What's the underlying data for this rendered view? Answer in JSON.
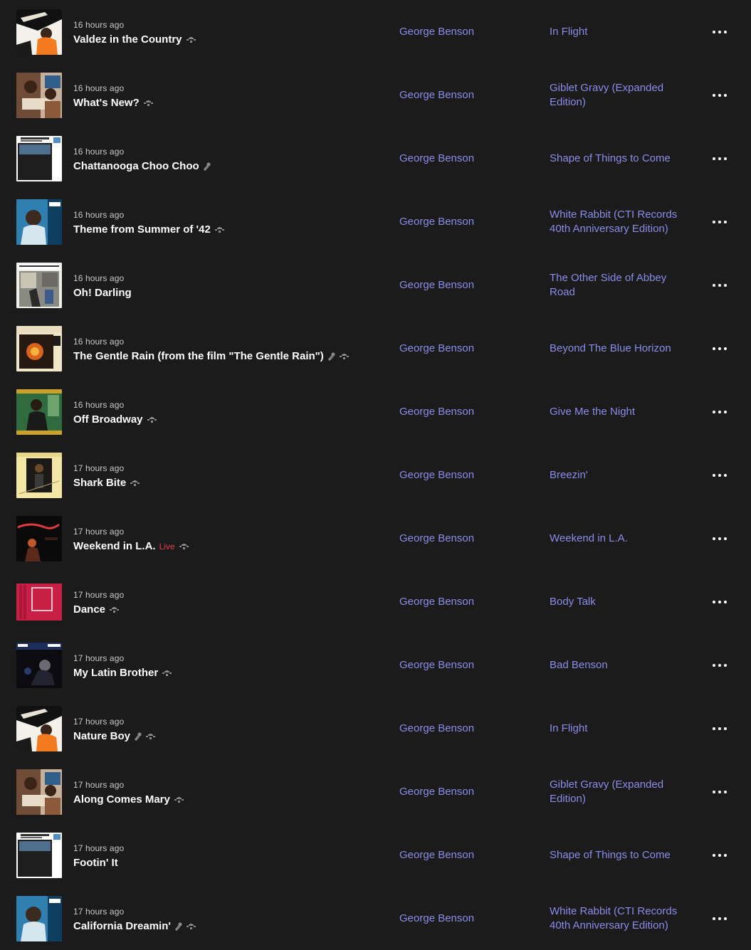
{
  "colors": {
    "background": "#1b1b1c",
    "link": "#8a8ce8",
    "live_badge": "#e8394a",
    "time": "#c9c9c9"
  },
  "tracks": [
    {
      "time": "16 hours ago",
      "title": "Valdez in the Country",
      "live": "",
      "icons": [
        "quality-icon"
      ],
      "artist": "George Benson",
      "album": "In Flight",
      "cover": "in-flight"
    },
    {
      "time": "16 hours ago",
      "title": "What's New?",
      "live": "",
      "icons": [
        "quality-icon"
      ],
      "artist": "George Benson",
      "album": "Giblet Gravy (Expanded Edition)",
      "cover": "giblet"
    },
    {
      "time": "16 hours ago",
      "title": "Chattanooga Choo Choo",
      "live": "",
      "icons": [
        "mic-icon"
      ],
      "artist": "George Benson",
      "album": "Shape of Things to Come",
      "cover": "shape"
    },
    {
      "time": "16 hours ago",
      "title": "Theme from Summer of '42",
      "live": "",
      "icons": [
        "quality-icon"
      ],
      "artist": "George Benson",
      "album": "White Rabbit (CTI Records 40th Anniversary Edition)",
      "cover": "white-rabbit"
    },
    {
      "time": "16 hours ago",
      "title": "Oh! Darling",
      "live": "",
      "icons": [],
      "artist": "George Benson",
      "album": "The Other Side of Abbey Road",
      "cover": "abbey"
    },
    {
      "time": "16 hours ago",
      "title": "The Gentle Rain (from the film \"The Gentle Rain\")",
      "live": "",
      "icons": [
        "mic-icon",
        "quality-icon"
      ],
      "artist": "George Benson",
      "album": "Beyond The Blue Horizon",
      "cover": "blue-horizon"
    },
    {
      "time": "16 hours ago",
      "title": "Off Broadway",
      "live": "",
      "icons": [
        "quality-icon"
      ],
      "artist": "George Benson",
      "album": "Give Me the Night",
      "cover": "give-night"
    },
    {
      "time": "17 hours ago",
      "title": "Shark Bite",
      "live": "",
      "icons": [
        "quality-icon"
      ],
      "artist": "George Benson",
      "album": "Breezin'",
      "cover": "breezin"
    },
    {
      "time": "17 hours ago",
      "title": "Weekend in L.A.",
      "live": "Live",
      "icons": [
        "quality-icon"
      ],
      "artist": "George Benson",
      "album": "Weekend in L.A.",
      "cover": "weekend"
    },
    {
      "time": "17 hours ago",
      "title": "Dance",
      "live": "",
      "icons": [
        "quality-icon"
      ],
      "artist": "George Benson",
      "album": "Body Talk",
      "cover": "body-talk"
    },
    {
      "time": "17 hours ago",
      "title": "My Latin Brother",
      "live": "",
      "icons": [
        "quality-icon"
      ],
      "artist": "George Benson",
      "album": "Bad Benson",
      "cover": "bad-benson"
    },
    {
      "time": "17 hours ago",
      "title": "Nature Boy",
      "live": "",
      "icons": [
        "mic-icon",
        "quality-icon"
      ],
      "artist": "George Benson",
      "album": "In Flight",
      "cover": "in-flight"
    },
    {
      "time": "17 hours ago",
      "title": "Along Comes Mary",
      "live": "",
      "icons": [
        "quality-icon"
      ],
      "artist": "George Benson",
      "album": "Giblet Gravy (Expanded Edition)",
      "cover": "giblet"
    },
    {
      "time": "17 hours ago",
      "title": "Footin' It",
      "live": "",
      "icons": [],
      "artist": "George Benson",
      "album": "Shape of Things to Come",
      "cover": "shape"
    },
    {
      "time": "17 hours ago",
      "title": "California Dreamin'",
      "live": "",
      "icons": [
        "mic-icon",
        "quality-icon"
      ],
      "artist": "George Benson",
      "album": "White Rabbit (CTI Records 40th Anniversary Edition)",
      "cover": "white-rabbit"
    }
  ]
}
